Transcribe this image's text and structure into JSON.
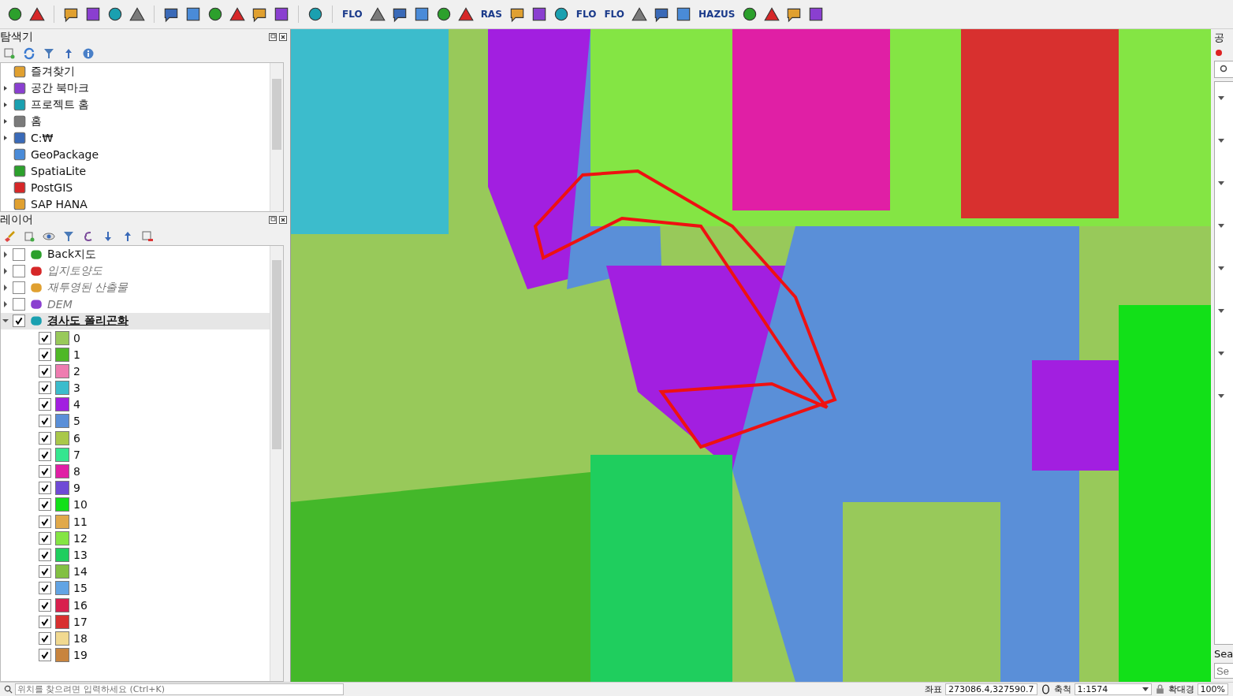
{
  "toolbar": {
    "items": [
      {
        "kind": "icon"
      },
      {
        "kind": "icon"
      },
      {
        "kind": "sep"
      },
      {
        "kind": "icon"
      },
      {
        "kind": "icon"
      },
      {
        "kind": "icon"
      },
      {
        "kind": "icon"
      },
      {
        "kind": "sep"
      },
      {
        "kind": "icon"
      },
      {
        "kind": "icon"
      },
      {
        "kind": "icon"
      },
      {
        "kind": "icon"
      },
      {
        "kind": "icon"
      },
      {
        "kind": "icon"
      },
      {
        "kind": "sep"
      },
      {
        "kind": "icon"
      },
      {
        "kind": "sep"
      },
      {
        "kind": "text",
        "label": "FLO"
      },
      {
        "kind": "icon"
      },
      {
        "kind": "icon"
      },
      {
        "kind": "icon"
      },
      {
        "kind": "icon"
      },
      {
        "kind": "icon"
      },
      {
        "kind": "text",
        "label": "RAS"
      },
      {
        "kind": "icon"
      },
      {
        "kind": "icon"
      },
      {
        "kind": "icon"
      },
      {
        "kind": "text",
        "label": "FLO"
      },
      {
        "kind": "text",
        "label": "FLO"
      },
      {
        "kind": "icon"
      },
      {
        "kind": "icon"
      },
      {
        "kind": "icon"
      },
      {
        "kind": "text",
        "label": "HAZUS"
      },
      {
        "kind": "icon"
      },
      {
        "kind": "icon"
      },
      {
        "kind": "icon"
      },
      {
        "kind": "icon"
      }
    ]
  },
  "browser": {
    "title": "탐색기",
    "items": [
      {
        "label": "즐겨찾기",
        "expandable": false
      },
      {
        "label": "공간 북마크",
        "expandable": true
      },
      {
        "label": "프로젝트 홈",
        "expandable": true
      },
      {
        "label": "홈",
        "expandable": true
      },
      {
        "label": "C:₩",
        "expandable": true
      },
      {
        "label": "GeoPackage",
        "expandable": false
      },
      {
        "label": "SpatiaLite",
        "expandable": false
      },
      {
        "label": "PostGIS",
        "expandable": false
      },
      {
        "label": "SAP HANA",
        "expandable": false
      }
    ]
  },
  "layers": {
    "title": "레이어",
    "items": [
      {
        "label": "Back지도",
        "checked": false,
        "greyed": false,
        "expanded": false,
        "current": false
      },
      {
        "label": "입지토양도",
        "checked": false,
        "greyed": true,
        "expanded": false,
        "current": false
      },
      {
        "label": "재투영된 산출물",
        "checked": false,
        "greyed": true,
        "expanded": false,
        "current": false
      },
      {
        "label": "DEM",
        "checked": false,
        "greyed": true,
        "expanded": false,
        "current": false
      },
      {
        "label": "경사도 폴리곤화",
        "checked": true,
        "greyed": false,
        "expanded": true,
        "current": true,
        "children": [
          {
            "label": "0",
            "color": "#98c95a",
            "checked": true
          },
          {
            "label": "1",
            "color": "#4fb827",
            "checked": true
          },
          {
            "label": "2",
            "color": "#ee7cb0",
            "checked": true
          },
          {
            "label": "3",
            "color": "#3cbccc",
            "checked": true
          },
          {
            "label": "4",
            "color": "#a21fe0",
            "checked": true
          },
          {
            "label": "5",
            "color": "#5a8fd8",
            "checked": true
          },
          {
            "label": "6",
            "color": "#a9c84a",
            "checked": true
          },
          {
            "label": "7",
            "color": "#35e68f",
            "checked": true
          },
          {
            "label": "8",
            "color": "#e01fa5",
            "checked": true
          },
          {
            "label": "9",
            "color": "#6f4ad6",
            "checked": true
          },
          {
            "label": "10",
            "color": "#12e018",
            "checked": true
          },
          {
            "label": "11",
            "color": "#e1a94a",
            "checked": true
          },
          {
            "label": "12",
            "color": "#84e544",
            "checked": true
          },
          {
            "label": "13",
            "color": "#1fce5e",
            "checked": true
          },
          {
            "label": "14",
            "color": "#82c043",
            "checked": true
          },
          {
            "label": "15",
            "color": "#62a4e4",
            "checked": true
          },
          {
            "label": "16",
            "color": "#d8204e",
            "checked": true
          },
          {
            "label": "17",
            "color": "#d8302f",
            "checked": true
          },
          {
            "label": "18",
            "color": "#f1d990",
            "checked": true
          },
          {
            "label": "19",
            "color": "#c8843e",
            "checked": true
          }
        ]
      }
    ]
  },
  "right_panel": {
    "title": "공",
    "section": "Sea",
    "search_placeholder": "Se"
  },
  "status_bar": {
    "locator_placeholder": "위치를 찾으려면 입력하세요 (Ctrl+K)",
    "coordinate_label": "좌표",
    "coordinate": "273086.4,327590.7",
    "scale_label": "축척",
    "scale": "1:1574",
    "magnifier_label": "확대경",
    "magnifier": "100%"
  }
}
